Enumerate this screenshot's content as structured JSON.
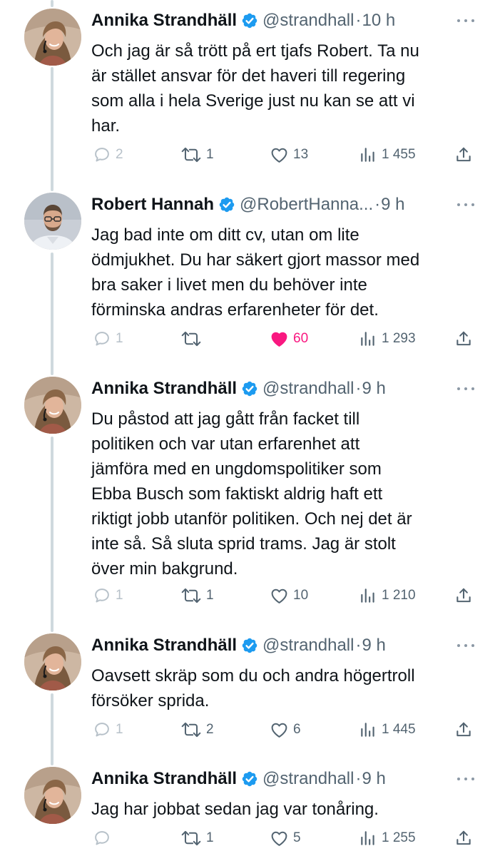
{
  "tweets": [
    {
      "author": "Annika Strandhäll",
      "handle": "@strandhall",
      "separator": "·",
      "time": "10 h",
      "text": "Och jag är så trött på ert tjafs Robert. Ta nu\när stället ansvar för det haveri till regering\nsom alla i hela Sverige just nu kan se att vi\nhar.",
      "replies": "2",
      "retweets": "1",
      "likes": "13",
      "views": "1 455",
      "liked": false
    },
    {
      "author": "Robert Hannah",
      "handle": "@RobertHanna...",
      "separator": "·",
      "time": "9 h",
      "text": "Jag bad inte om ditt cv, utan om lite\nödmjukhet. Du har säkert gjort massor med\nbra saker i livet men du behöver inte\nförminska andras erfarenheter för det.",
      "replies": "1",
      "retweets": "",
      "likes": "60",
      "views": "1 293",
      "liked": true
    },
    {
      "author": "Annika Strandhäll",
      "handle": "@strandhall",
      "separator": "·",
      "time": "9 h",
      "text": "Du påstod att jag gått från facket till\npolitiken och var utan erfarenhet att\njämföra med en ungdomspolitiker som\nEbba Busch som faktiskt aldrig haft ett\nriktigt jobb utanför politiken. Och nej det är\ninte så. Så sluta sprid trams. Jag är stolt\növer min bakgrund.",
      "replies": "1",
      "retweets": "1",
      "likes": "10",
      "views": "1 210",
      "liked": false
    },
    {
      "author": "Annika Strandhäll",
      "handle": "@strandhall",
      "separator": "·",
      "time": "9 h",
      "text": "Oavsett skräp som du och andra högertroll\nförsöker sprida.",
      "replies": "1",
      "retweets": "2",
      "likes": "6",
      "views": "1 445",
      "liked": false
    },
    {
      "author": "Annika Strandhäll",
      "handle": "@strandhall",
      "separator": "·",
      "time": "9 h",
      "text": "Jag har jobbat sedan jag var tonåring.",
      "replies": "",
      "retweets": "1",
      "likes": "5",
      "views": "1 255",
      "liked": false
    }
  ],
  "icons": {
    "verified": "verified-badge-icon",
    "more": "more-options-icon",
    "reply": "reply-icon",
    "retweet": "retweet-icon",
    "like": "like-icon",
    "views": "views-icon",
    "share": "share-icon"
  },
  "colors": {
    "text": "#0f1419",
    "muted": "#536471",
    "verified": "#1d9bf0",
    "like": "#f91880",
    "thread_line": "#cfd9de"
  }
}
